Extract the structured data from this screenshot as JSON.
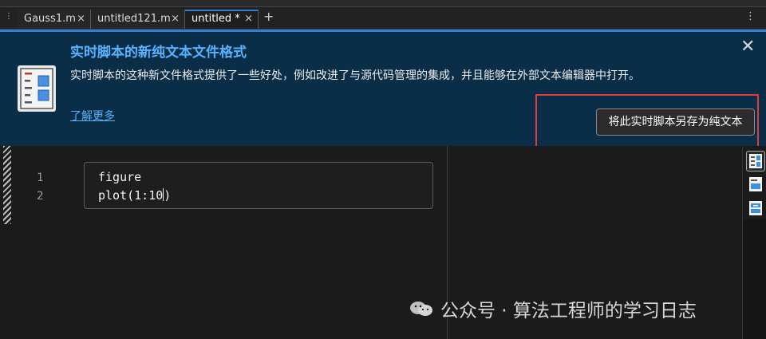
{
  "tabs": [
    {
      "label": "Gauss1.m",
      "active": false
    },
    {
      "label": "untitled121.m",
      "active": false
    },
    {
      "label": "untitled *",
      "active": true
    }
  ],
  "tab_close_glyph": "×",
  "tab_add_glyph": "+",
  "banner": {
    "title": "实时脚本的新纯文本文件格式",
    "body": "实时脚本的这种新文件格式提供了一些好处，例如改进了与源代码管理的集成，并且能够在外部文本编辑器中打开。",
    "link": "了解更多",
    "button": "将此实时脚本另存为纯文本",
    "close_glyph": "✕"
  },
  "editor": {
    "line_numbers": [
      "1",
      "2"
    ],
    "code_lines": [
      "figure",
      "plot(1:10)"
    ],
    "cursor_after": "plot(1:10",
    "cursor_rest": ")"
  },
  "watermark": {
    "text": "公众号 · 算法工程师的学习日志"
  },
  "colors": {
    "accent": "#2f7fd6",
    "banner_bg": "#0a2e47",
    "banner_title": "#5ab2ff",
    "highlight_border": "#e03a3a"
  },
  "icons": [
    "live-script-icon",
    "close-icon",
    "output-inline-icon",
    "output-right-icon",
    "hide-code-icon",
    "wechat-icon"
  ]
}
